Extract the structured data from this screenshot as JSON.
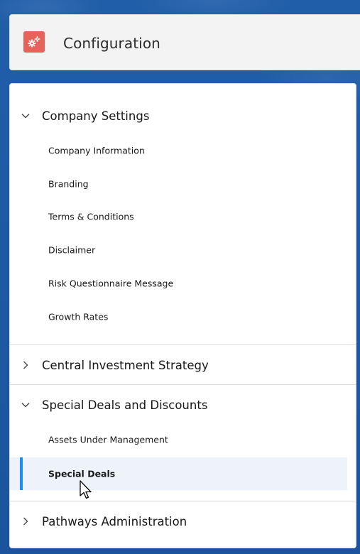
{
  "header": {
    "title": "Configuration",
    "icon": "gears-icon",
    "icon_color": "#e8625c"
  },
  "menu": {
    "sections": [
      {
        "label": "Company Settings",
        "expanded": true,
        "items": [
          {
            "label": "Company Information"
          },
          {
            "label": "Branding"
          },
          {
            "label": "Terms & Conditions"
          },
          {
            "label": "Disclaimer"
          },
          {
            "label": "Risk Questionnaire Message"
          },
          {
            "label": "Growth Rates"
          }
        ]
      },
      {
        "label": "Central Investment Strategy",
        "expanded": false,
        "items": []
      },
      {
        "label": "Special Deals and Discounts",
        "expanded": true,
        "items": [
          {
            "label": "Assets Under Management"
          },
          {
            "label": "Special Deals",
            "active": true
          }
        ]
      },
      {
        "label": "Pathways Administration",
        "expanded": false,
        "items": []
      }
    ]
  },
  "colors": {
    "background": "#1e5aa6",
    "active_bar": "#1b8ef2",
    "active_bg": "#eef3fb"
  }
}
